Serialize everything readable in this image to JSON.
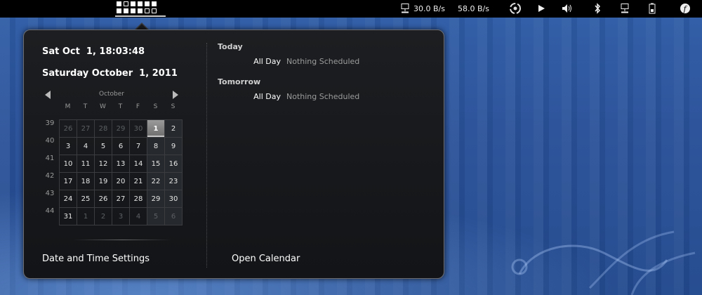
{
  "topbar": {
    "network": {
      "down": "30.0 B/s",
      "up": "58.0 B/s"
    },
    "tray_icons": [
      "network-icon",
      "swirl-app-icon",
      "play-icon",
      "volume-icon",
      "bluetooth-icon",
      "network-connection-icon",
      "battery-icon",
      "fedora-icon"
    ]
  },
  "popup": {
    "datetime_short": "Sat Oct  1, 18:03:48",
    "date_long": "Saturday October  1, 2011",
    "calendar": {
      "month": "October",
      "weekdays": [
        "M",
        "T",
        "W",
        "T",
        "F",
        "S",
        "S"
      ],
      "week_numbers": [
        "39",
        "40",
        "41",
        "42",
        "43",
        "44"
      ],
      "weeks": [
        [
          "26",
          "27",
          "28",
          "29",
          "30",
          "1",
          "2"
        ],
        [
          "3",
          "4",
          "5",
          "6",
          "7",
          "8",
          "9"
        ],
        [
          "10",
          "11",
          "12",
          "13",
          "14",
          "15",
          "16"
        ],
        [
          "17",
          "18",
          "19",
          "20",
          "21",
          "22",
          "23"
        ],
        [
          "24",
          "25",
          "26",
          "27",
          "28",
          "29",
          "30"
        ],
        [
          "31",
          "1",
          "2",
          "3",
          "4",
          "5",
          "6"
        ]
      ],
      "selected_day": "1"
    },
    "events": {
      "today_title": "Today",
      "today_time": "All Day",
      "today_desc": "Nothing Scheduled",
      "tomorrow_title": "Tomorrow",
      "tomorrow_time": "All Day",
      "tomorrow_desc": "Nothing Scheduled"
    },
    "date_time_settings": "Date and Time Settings",
    "open_calendar": "Open Calendar"
  },
  "colors": {
    "topbar_bg": "#000000",
    "popup_bg": "#16181b",
    "today_highlight": "#8a8a8a",
    "wallpaper": "#2a5199"
  }
}
